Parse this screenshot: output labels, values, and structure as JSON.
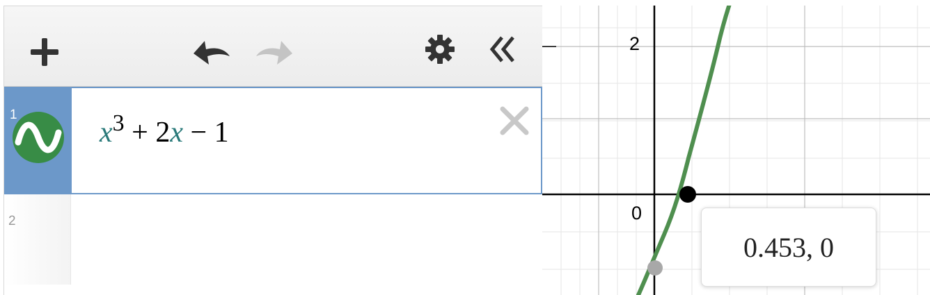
{
  "toolbar": {
    "add_icon": "plus-icon",
    "undo_icon": "undo-arrow-icon",
    "redo_icon": "redo-arrow-icon",
    "settings_icon": "gear-icon",
    "collapse_icon": "double-chevron-left-icon"
  },
  "expressions": [
    {
      "index": "1",
      "active": true,
      "icon": "wave-graph-icon",
      "color": "#388c46",
      "latex_parts": {
        "var1": "x",
        "exp": "3",
        "mid": " + 2",
        "var2": "x",
        "tail": " − 1"
      }
    },
    {
      "index": "2",
      "active": false
    }
  ],
  "graph": {
    "y_tick_labels": {
      "two": "2",
      "origin": "0"
    },
    "curve_color": "#4f8f4f",
    "highlighted_point": {
      "x": 0.453,
      "y": 0
    },
    "tooltip": "0.453, 0"
  },
  "colors": {
    "active_tab": "#6c98c9",
    "icon_green": "#388c46",
    "variable_teal": "#2a7a7a"
  }
}
